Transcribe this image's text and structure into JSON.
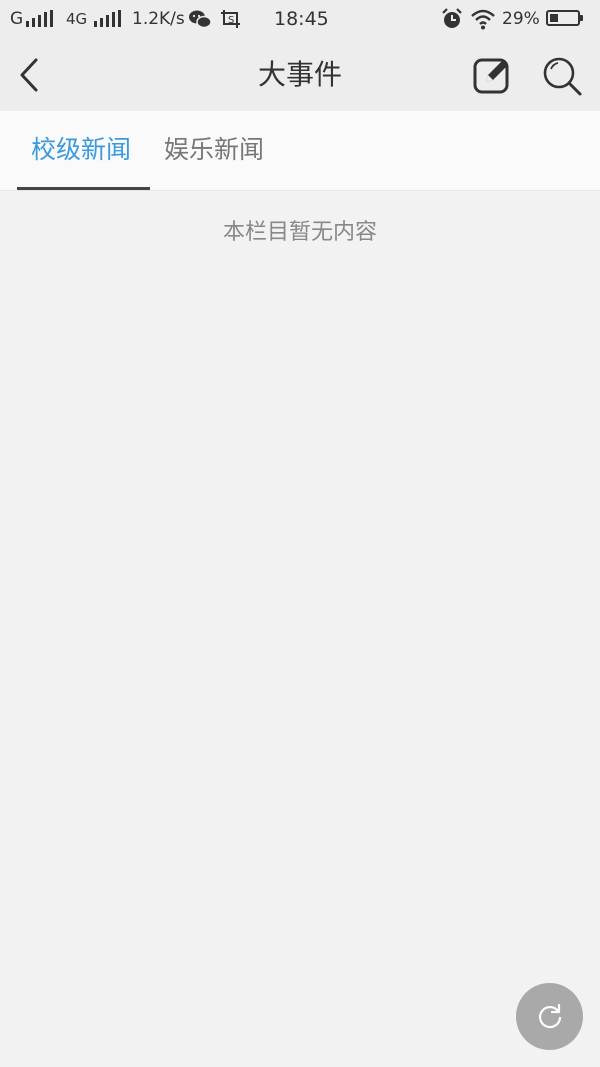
{
  "status_bar": {
    "carrier1": "G",
    "carrier2": "4G",
    "net_speed": "1.2K/s",
    "time": "18:45",
    "battery_percent": "29%",
    "battery_level": 0.29,
    "icons": [
      "signal-icon",
      "wechat-icon",
      "screenshot-icon",
      "alarm-icon",
      "wifi-icon",
      "battery-icon"
    ]
  },
  "header": {
    "title": "大事件",
    "back_icon": "chevron-left-icon",
    "edit_icon": "edit-icon",
    "search_icon": "search-icon"
  },
  "tabs": [
    {
      "label": "校级新闻",
      "active": true
    },
    {
      "label": "娱乐新闻",
      "active": false
    }
  ],
  "content": {
    "empty_message": "本栏目暂无内容"
  },
  "fab": {
    "icon": "refresh-icon"
  },
  "colors": {
    "accent": "#3a9ae0",
    "background": "#f2f2f2",
    "header_bg": "#ededed",
    "fab_bg": "#a9a9a9"
  }
}
